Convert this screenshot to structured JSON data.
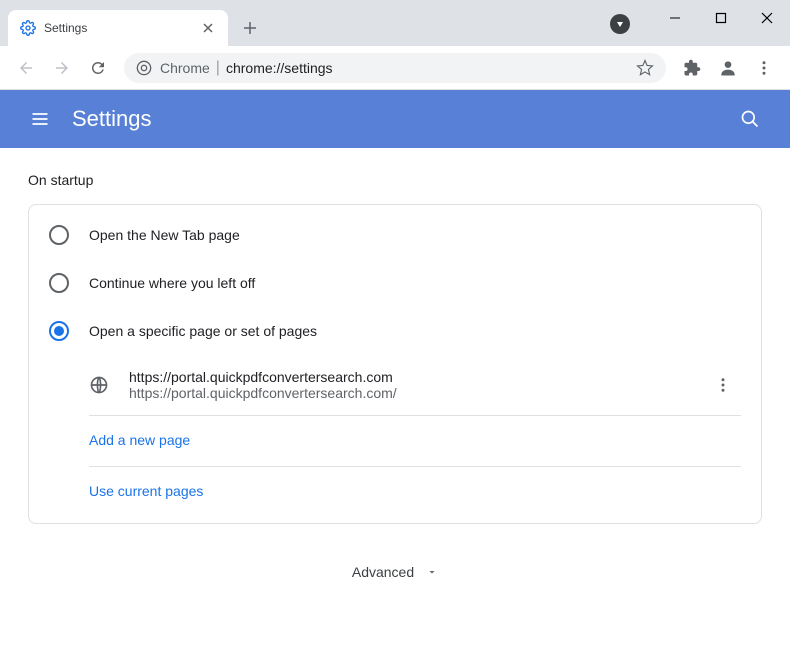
{
  "window": {
    "tab_title": "Settings"
  },
  "omnibox": {
    "prefix": "Chrome",
    "url": "chrome://settings"
  },
  "header": {
    "title": "Settings"
  },
  "startup": {
    "section_title": "On startup",
    "options": {
      "new_tab": "Open the New Tab page",
      "continue": "Continue where you left off",
      "specific": "Open a specific page or set of pages"
    },
    "pages": [
      {
        "title": "https://portal.quickpdfconvertersearch.com",
        "url": "https://portal.quickpdfconvertersearch.com/"
      }
    ],
    "add_new": "Add a new page",
    "use_current": "Use current pages"
  },
  "advanced": {
    "label": "Advanced"
  }
}
